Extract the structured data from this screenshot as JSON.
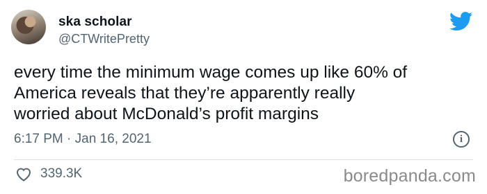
{
  "author": {
    "display_name": "ska scholar",
    "handle": "@CTWritePretty"
  },
  "tweet": {
    "text": "every time the minimum wage comes up like 60% of\nAmerica reveals that they’re apparently really\nworried about McDonald’s profit margins",
    "timestamp": "6:17 PM · Jan 16, 2021",
    "likes": "339.3K"
  },
  "icons": {
    "brand": "twitter-bird-icon",
    "info": "info-icon",
    "like": "heart-icon"
  },
  "watermark": "boredpanda.com",
  "colors": {
    "twitter_blue": "#1d9bf0",
    "muted_text": "#536471",
    "body_text": "#0f1419"
  }
}
